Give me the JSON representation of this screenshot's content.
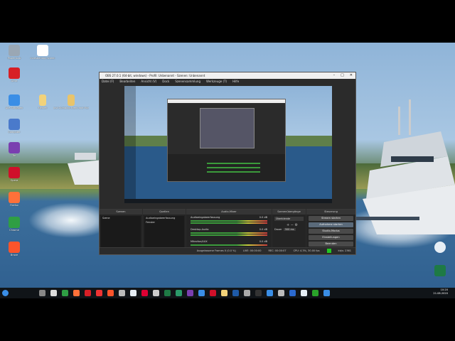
{
  "desktop": {
    "icons_left": [
      {
        "label": "Papierkorb",
        "icon": "recycle-bin-icon",
        "color": "#9aa7b4"
      },
      {
        "label": "Avira",
        "icon": "avira-icon",
        "color": "#d71f26"
      },
      {
        "label": "Alle Aufgaben",
        "icon": "folder-icon",
        "color": "#3a8ee6"
      },
      {
        "label": "Computer",
        "icon": "computer-icon",
        "color": "#4a7acb"
      },
      {
        "label": "Tor",
        "icon": "tor-icon",
        "color": "#7a3fb0"
      },
      {
        "label": "Opera",
        "icon": "opera-icon",
        "color": "#d0102a"
      },
      {
        "label": "Firefox",
        "icon": "firefox-icon",
        "color": "#ff7139"
      },
      {
        "label": "Chrome",
        "icon": "chrome-icon",
        "color": "#2f9e44"
      },
      {
        "label": "Brave",
        "icon": "brave-icon",
        "color": "#fb542b"
      }
    ],
    "icons_top": [
      {
        "label": "Investierung Screen",
        "icon": "document-icon",
        "color": "#ffffff"
      },
      {
        "label": "Medien",
        "icon": "file-icon",
        "color": "#f2d27a"
      },
      {
        "label": "Just Dumping Event and More",
        "icon": "folder-icon",
        "color": "#e9c46a"
      }
    ],
    "icons_right": [
      {
        "label": "",
        "icon": "app-icon",
        "color": "#e6eef5"
      },
      {
        "label": "",
        "icon": "excel-icon",
        "color": "#1e7a45"
      }
    ]
  },
  "obs": {
    "title": "OBS 27.0.1 (64-bit, windows) - Profil: Unbenannt - Szenen: Unbenannt",
    "menu": [
      "Datei (F)",
      "Bearbeiten",
      "Ansicht (V)",
      "Dock",
      "Szenensammlung",
      "Werkzeuge (T)",
      "Hilfe"
    ],
    "docks": {
      "scenes": {
        "header": "Szenen",
        "item": "Szene"
      },
      "sources": {
        "header": "Quellen",
        "items": [
          "Audioeingabeerfassung",
          "Fenster"
        ]
      },
      "mixer": {
        "header": "Audio-Mixer",
        "rows": [
          "Audioeingabeerfassung",
          "Desktop-Audio",
          "Mikrofon/AUX"
        ],
        "values": [
          "0.0 dB",
          "0.0 dB",
          "0.0 dB"
        ]
      },
      "transitions": {
        "header": "Szenenübergänge",
        "type": "Überblende",
        "duration_label": "Dauer",
        "duration": "300 ms"
      },
      "controls": {
        "header": "Steuerung",
        "buttons": [
          "Stream starten",
          "Aufnahme starten",
          "Studio-Modus",
          "Einstellungen",
          "Beenden"
        ]
      }
    },
    "status": {
      "dropped": "Ausgelassene Frames 0 (0.0 %)",
      "live": "LIVE: 00:00:00",
      "rec": "REC: 00:00:07",
      "cpu": "CPU: 4.3%, 30.00 fps",
      "kbps": "kb/s: 2361"
    }
  },
  "taskbar": {
    "time": "10:20",
    "date": "21.08.2020"
  }
}
